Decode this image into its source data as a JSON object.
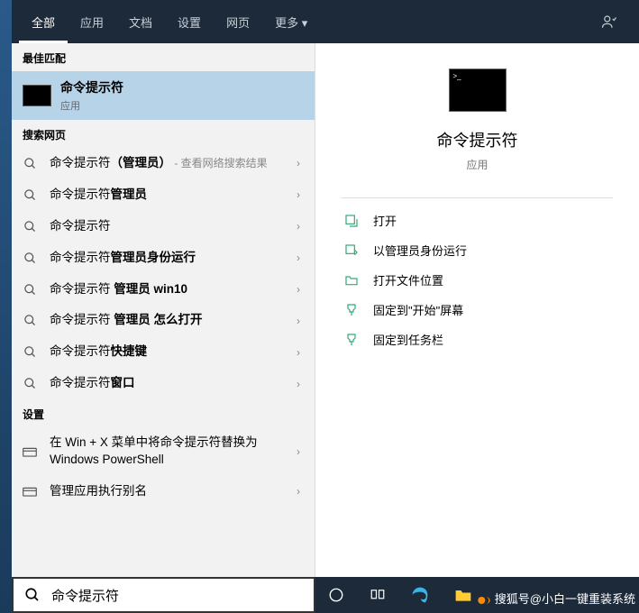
{
  "header": {
    "tabs": [
      "全部",
      "应用",
      "文档",
      "设置",
      "网页",
      "更多"
    ],
    "more_caret": "▾"
  },
  "sections": {
    "best_match": "最佳匹配",
    "search_web": "搜索网页",
    "settings": "设置"
  },
  "best": {
    "title": "命令提示符",
    "sub": "应用"
  },
  "web_results": [
    {
      "prefix": "命令提示符",
      "bold": "（管理员）",
      "hint": " - 查看网络搜索结果"
    },
    {
      "prefix": "命令提示符",
      "bold": "管理员"
    },
    {
      "prefix": "命令提示符",
      "bold": ""
    },
    {
      "prefix": "命令提示符",
      "bold": "管理员身份运行"
    },
    {
      "prefix": "命令提示符 ",
      "bold": "管理员 win10"
    },
    {
      "prefix": "命令提示符 ",
      "bold": "管理员 怎么打开"
    },
    {
      "prefix": "命令提示符",
      "bold": "快捷键"
    },
    {
      "prefix": "命令提示符",
      "bold": "窗口"
    }
  ],
  "settings_items": [
    "在 Win + X 菜单中将命令提示符替换为 Windows PowerShell",
    "管理应用执行别名"
  ],
  "detail": {
    "title": "命令提示符",
    "sub": "应用",
    "actions": [
      {
        "icon": "open",
        "label": "打开"
      },
      {
        "icon": "admin",
        "label": "以管理员身份运行"
      },
      {
        "icon": "folder",
        "label": "打开文件位置"
      },
      {
        "icon": "pin-start",
        "label": "固定到\"开始\"屏幕"
      },
      {
        "icon": "pin-task",
        "label": "固定到任务栏"
      }
    ]
  },
  "search_input": "命令提示符",
  "watermark": "搜狐号@小白一键重装系统"
}
